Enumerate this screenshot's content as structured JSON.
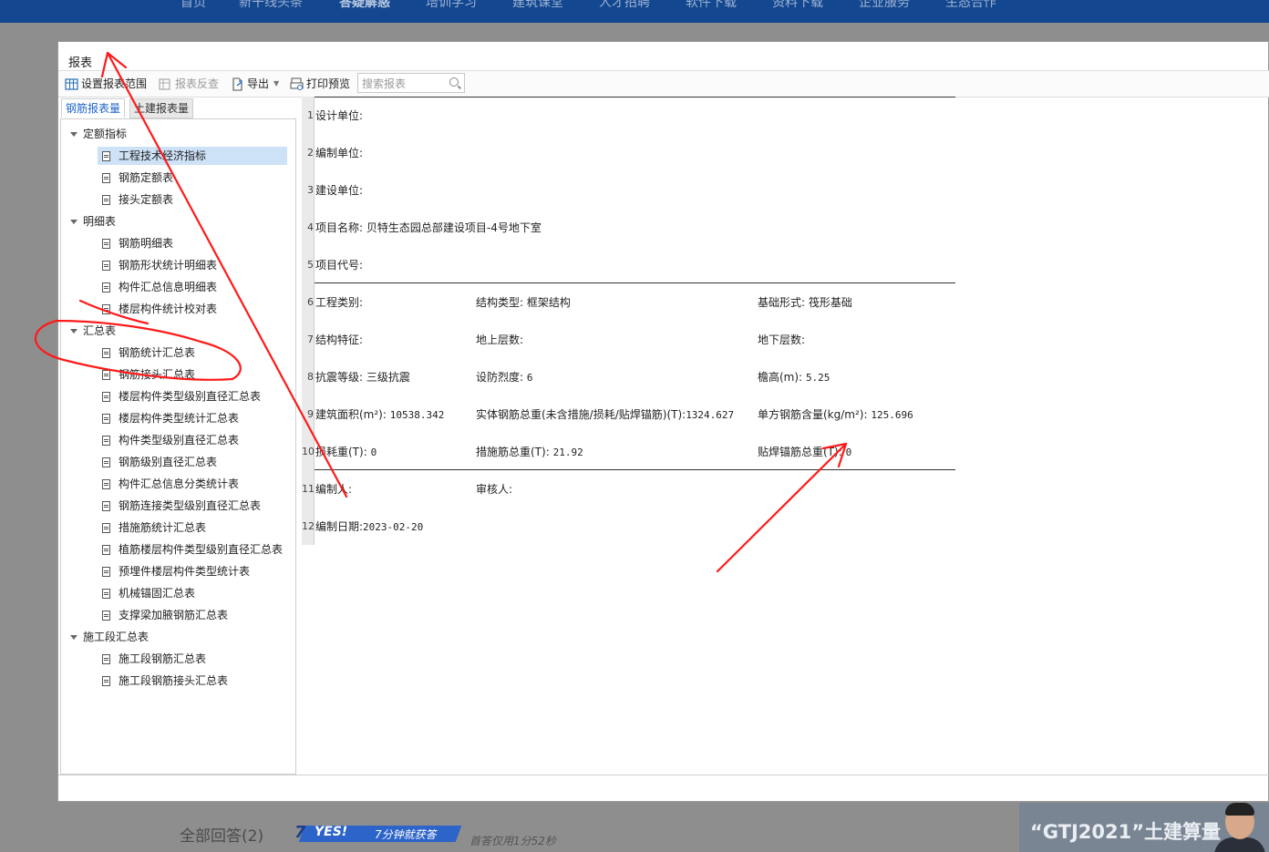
{
  "topnav": [
    "首页",
    "新干线头条",
    "答疑解惑",
    "培训学习",
    "建筑课堂",
    "人才招聘",
    "软件下载",
    "资料下载",
    "企业服务",
    "生态合作"
  ],
  "window": {
    "title": "报表"
  },
  "toolbar": {
    "set_range": "设置报表范围",
    "reverse": "报表反查",
    "export": "导出",
    "print_preview": "打印预览",
    "search_placeholder": "搜索报表"
  },
  "tabs": {
    "rebar": "钢筋报表量",
    "civil": "土建报表量"
  },
  "tree": [
    {
      "group": "定额指标",
      "items": [
        "工程技术经济指标",
        "钢筋定额表",
        "接头定额表"
      ],
      "selected": 0
    },
    {
      "group": "明细表",
      "items": [
        "钢筋明细表",
        "钢筋形状统计明细表",
        "构件汇总信息明细表",
        "楼层构件统计校对表"
      ]
    },
    {
      "group": "汇总表",
      "items": [
        "钢筋统计汇总表",
        "钢筋接头汇总表",
        "楼层构件类型级别直径汇总表",
        "楼层构件类型统计汇总表",
        "构件类型级别直径汇总表",
        "钢筋级别直径汇总表",
        "构件汇总信息分类统计表",
        "钢筋连接类型级别直径汇总表",
        "措施筋统计汇总表",
        "植筋楼层构件类型级别直径汇总表",
        "预埋件楼层构件类型统计表",
        "机械锚固汇总表",
        "支撑梁加腋钢筋汇总表"
      ]
    },
    {
      "group": "施工段汇总表",
      "items": [
        "施工段钢筋汇总表",
        "施工段钢筋接头汇总表"
      ]
    }
  ],
  "report": {
    "row_numbers": [
      "1",
      "2",
      "3",
      "4",
      "5",
      "6",
      "7",
      "8",
      "9",
      "10",
      "11",
      "12"
    ],
    "rows": [
      {
        "c1": "设计单位:"
      },
      {
        "c1": "编制单位:"
      },
      {
        "c1": "建设单位:"
      },
      {
        "c1": "项目名称: 贝特生态园总部建设项目-4号地下室"
      },
      {
        "c1": "项目代号:"
      },
      {
        "c1": "工程类别:",
        "c2": "结构类型: 框架结构",
        "c3": "基础形式: 筏形基础"
      },
      {
        "c1": "结构特征:",
        "c2": "地上层数:",
        "c3": "地下层数:"
      },
      {
        "c1": "抗震等级: 三级抗震",
        "c2_label": "设防烈度:",
        "c2_val": "6",
        "c3_label": "檐高(m):",
        "c3_val": "5.25"
      },
      {
        "c1_label": "建筑面积(m²):",
        "c1_val": "10538.342",
        "c2_label": "实体钢筋总重(未含措施/损耗/贴焊锚筋)(T):",
        "c2_val": "1324.627",
        "c3_label": "单方钢筋含量(kg/m²):",
        "c3_val": "125.696"
      },
      {
        "c1_label": "损耗重(T):",
        "c1_val": "0",
        "c2_label": "措施筋总重(T):",
        "c2_val": "21.92",
        "c3_label": "贴焊锚筋总重(T):",
        "c3_val": "0"
      },
      {
        "c1": "编制人:",
        "c2": "审核人:"
      },
      {
        "c1_label": "编制日期:",
        "c1_val": "2023-02-20"
      }
    ]
  },
  "footer": {
    "answers": "全部回答(2)",
    "badge_main": "YES!",
    "badge_sub": "7分钟就获答",
    "badge_num": "7",
    "first_answer": "首答仅用1分52秒",
    "ad_text": "“GTJ2021”土建算量"
  },
  "colors": {
    "nav": "#13478f",
    "annotation": "#ff1a1a",
    "selected": "#cde1f7",
    "tab_active": "#1f64c9"
  }
}
